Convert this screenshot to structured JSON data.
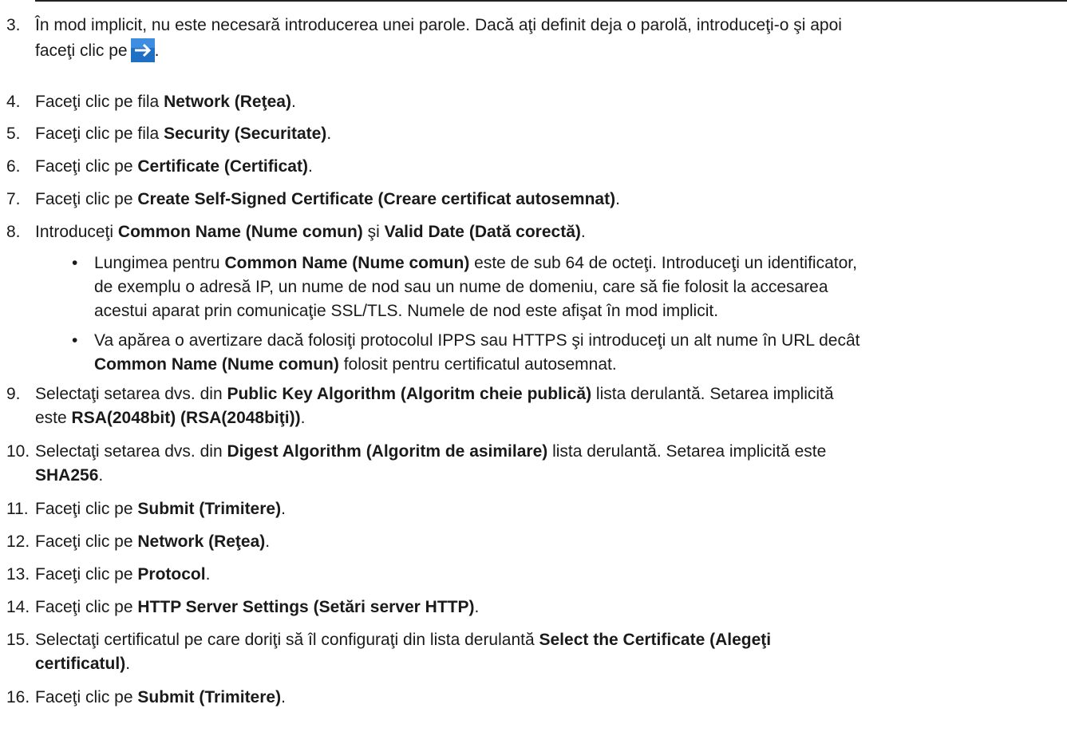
{
  "step3": {
    "num": "3.",
    "line1": "În mod implicit, nu este necesară introducerea unei parole. Dacă aţi definit deja o parolă, introduceţi-o şi apoi",
    "line2_pre": "faceţi clic pe",
    "line2_post": ".",
    "icon": "arrow-right-icon",
    "icon_color": "#1f6fc5"
  },
  "step4": {
    "num": "4.",
    "pre": "Faceţi clic pe fila ",
    "bold": "Network (Reţea)",
    "post": "."
  },
  "step5": {
    "num": "5.",
    "pre": "Faceţi clic pe fila ",
    "bold": "Security (Securitate)",
    "post": "."
  },
  "step6": {
    "num": "6.",
    "pre": "Faceţi clic pe ",
    "bold": "Certificate (Certificat)",
    "post": "."
  },
  "step7": {
    "num": "7.",
    "pre": "Faceţi clic pe ",
    "bold": "Create Self-Signed Certificate (Creare certificat autosemnat)",
    "post": "."
  },
  "step8": {
    "num": "8.",
    "pre": "Introduceţi ",
    "bold1": "Common Name (Nume comun)",
    "mid": " şi ",
    "bold2": "Valid Date (Dată corectă)",
    "post": ".",
    "bullets": [
      {
        "dot": "•",
        "l1_pre": "Lungimea pentru ",
        "l1_bold": "Common Name (Nume comun)",
        "l1_post": " este de sub 64 de octeţi. Introduceţi un identificator,",
        "l2": "de exemplu o adresă IP, un nume de nod sau un nume de domeniu, care să fie folosit la accesarea",
        "l3": "acestui aparat prin comunicaţie SSL/TLS. Numele de nod este afişat în mod implicit."
      },
      {
        "dot": "•",
        "l1": "Va apărea o avertizare dacă folosiţi protocolul IPPS sau HTTPS şi introduceţi un alt nume în URL decât",
        "l2_bold": "Common Name (Nume comun)",
        "l2_post": " folosit pentru certificatul autosemnat."
      }
    ]
  },
  "step9": {
    "num": "9.",
    "l1_pre": "Selectaţi setarea dvs. din ",
    "l1_bold": "Public Key Algorithm (Algoritm cheie publică)",
    "l1_post": " lista derulantă. Setarea implicită",
    "l2_pre": "este ",
    "l2_bold": "RSA(2048bit) (RSA(2048biţi))",
    "l2_post": "."
  },
  "step10": {
    "num": "10.",
    "l1_pre": "Selectaţi setarea dvs. din ",
    "l1_bold": "Digest Algorithm (Algoritm de asimilare)",
    "l1_post": " lista derulantă. Setarea implicită este",
    "l2_bold": "SHA256",
    "l2_post": "."
  },
  "step11": {
    "num": "11.",
    "pre": "Faceţi clic pe ",
    "bold": "Submit (Trimitere)",
    "post": "."
  },
  "step12": {
    "num": "12.",
    "pre": "Faceţi clic pe ",
    "bold": "Network (Reţea)",
    "post": "."
  },
  "step13": {
    "num": "13.",
    "pre": "Faceţi clic pe ",
    "bold": "Protocol",
    "post": "."
  },
  "step14": {
    "num": "14.",
    "pre": "Faceţi clic pe ",
    "bold": "HTTP Server Settings (Setări server HTTP)",
    "post": "."
  },
  "step15": {
    "num": "15.",
    "l1_pre": "Selectaţi certificatul pe care doriţi să îl configuraţi din lista derulantă ",
    "l1_bold": "Select the Certificate (Alegeţi",
    "l2_bold": "certificatul)",
    "l2_post": "."
  },
  "step16": {
    "num": "16.",
    "pre": "Faceţi clic pe ",
    "bold": "Submit (Trimitere)",
    "post": "."
  }
}
